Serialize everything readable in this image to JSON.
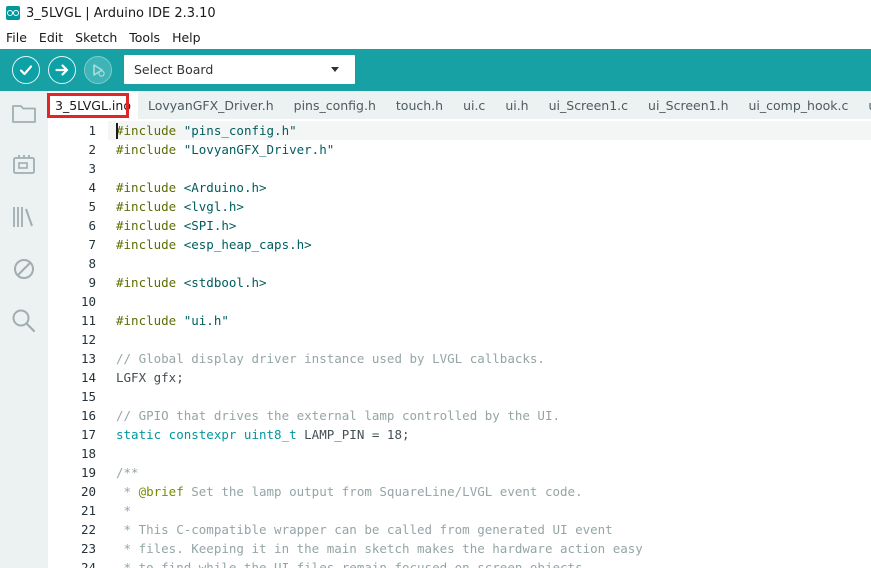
{
  "window": {
    "title": "3_5LVGL | Arduino IDE 2.3.10"
  },
  "menu": [
    "File",
    "Edit",
    "Sketch",
    "Tools",
    "Help"
  ],
  "toolbar": {
    "verify_icon": "check-icon",
    "upload_icon": "arrow-right-icon",
    "debug_icon": "debug-icon",
    "board_select_label": "Select Board",
    "accent": "#17a1a5"
  },
  "sidebar": [
    "folder-icon",
    "board-icon",
    "library-icon",
    "debug-icon",
    "search-icon"
  ],
  "tabs": [
    "3_5LVGL.ino",
    "LovyanGFX_Driver.h",
    "pins_config.h",
    "touch.h",
    "ui.c",
    "ui.h",
    "ui_Screen1.c",
    "ui_Screen1.h",
    "ui_comp_hook.c",
    "ui_events"
  ],
  "active_tab_index": 0,
  "code": {
    "lines": [
      [
        [
          "pre",
          "#include "
        ],
        [
          "str",
          "\"pins_config.h\""
        ]
      ],
      [
        [
          "pre",
          "#include "
        ],
        [
          "str",
          "\"LovyanGFX_Driver.h\""
        ]
      ],
      [],
      [
        [
          "pre",
          "#include "
        ],
        [
          "str",
          "<Arduino.h>"
        ]
      ],
      [
        [
          "pre",
          "#include "
        ],
        [
          "str",
          "<lvgl.h>"
        ]
      ],
      [
        [
          "pre",
          "#include "
        ],
        [
          "str",
          "<SPI.h>"
        ]
      ],
      [
        [
          "pre",
          "#include "
        ],
        [
          "str",
          "<esp_heap_caps.h>"
        ]
      ],
      [],
      [
        [
          "pre",
          "#include "
        ],
        [
          "str",
          "<stdbool.h>"
        ]
      ],
      [],
      [
        [
          "pre",
          "#include "
        ],
        [
          "str",
          "\"ui.h\""
        ]
      ],
      [],
      [
        [
          "cmt",
          "// Global display driver instance used by LVGL callbacks."
        ]
      ],
      [
        [
          "plain",
          "LGFX gfx;"
        ]
      ],
      [],
      [
        [
          "cmt",
          "// GPIO that drives the external lamp controlled by the UI."
        ]
      ],
      [
        [
          "type",
          "static constexpr uint8_t"
        ],
        [
          "plain",
          " LAMP_PIN = 18;"
        ]
      ],
      [],
      [
        [
          "cmt",
          "/**"
        ]
      ],
      [
        [
          "cmt",
          " * "
        ],
        [
          "tag",
          "@brief"
        ],
        [
          "cmt",
          " Set the lamp output from SquareLine/LVGL event code."
        ]
      ],
      [
        [
          "cmt",
          " *"
        ]
      ],
      [
        [
          "cmt",
          " * This C-compatible wrapper can be called from generated UI event"
        ]
      ],
      [
        [
          "cmt",
          " * files. Keeping it in the main sketch makes the hardware action easy"
        ]
      ],
      [
        [
          "cmt",
          " * to find while the UI files remain focused on screen objects."
        ]
      ]
    ]
  }
}
